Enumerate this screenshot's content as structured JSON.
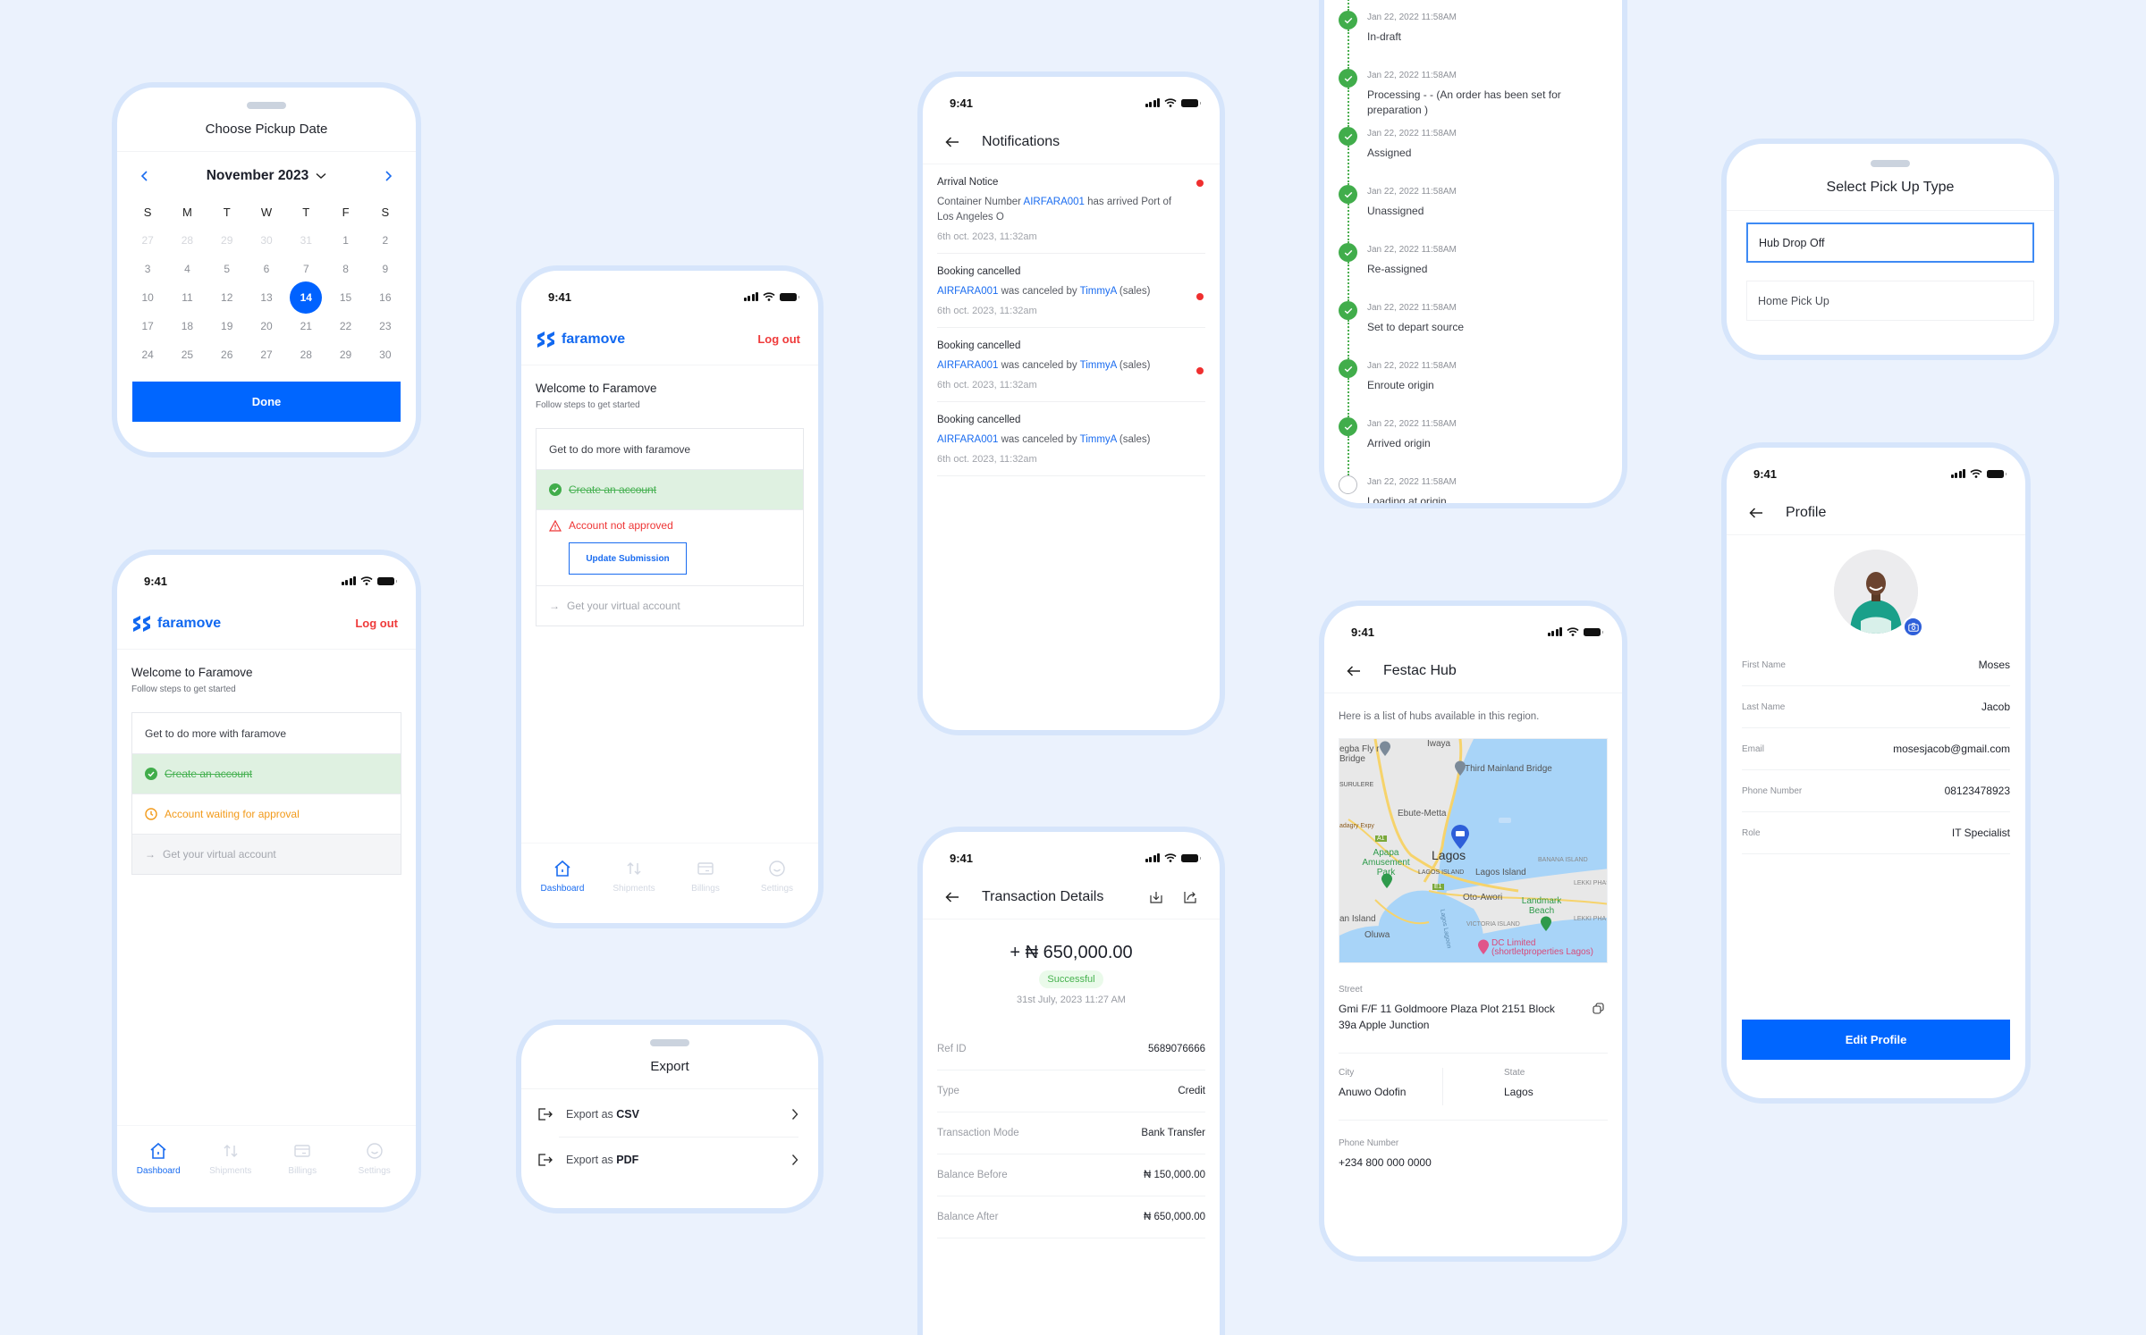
{
  "status_bar": {
    "time": "9:41"
  },
  "brand": {
    "name": "faramove",
    "primary_color": "#0066ff",
    "logout_color": "#ef3b3b"
  },
  "calendar_sheet": {
    "title": "Choose Pickup Date",
    "month_label": "November 2023",
    "weekdays": [
      "S",
      "M",
      "T",
      "W",
      "T",
      "F",
      "S"
    ],
    "weeks": [
      [
        {
          "d": "27",
          "out": true
        },
        {
          "d": "28",
          "out": true
        },
        {
          "d": "29",
          "out": true
        },
        {
          "d": "30",
          "out": true
        },
        {
          "d": "31",
          "out": true
        },
        {
          "d": "1"
        },
        {
          "d": "2"
        }
      ],
      [
        {
          "d": "3"
        },
        {
          "d": "4"
        },
        {
          "d": "5"
        },
        {
          "d": "6"
        },
        {
          "d": "7"
        },
        {
          "d": "8"
        },
        {
          "d": "9"
        }
      ],
      [
        {
          "d": "10"
        },
        {
          "d": "11"
        },
        {
          "d": "12"
        },
        {
          "d": "13"
        },
        {
          "d": "14",
          "selected": true
        },
        {
          "d": "15"
        },
        {
          "d": "16"
        }
      ],
      [
        {
          "d": "17"
        },
        {
          "d": "18"
        },
        {
          "d": "19"
        },
        {
          "d": "20"
        },
        {
          "d": "21"
        },
        {
          "d": "22"
        },
        {
          "d": "23"
        }
      ],
      [
        {
          "d": "24"
        },
        {
          "d": "25"
        },
        {
          "d": "26"
        },
        {
          "d": "27"
        },
        {
          "d": "28"
        },
        {
          "d": "29"
        },
        {
          "d": "30"
        }
      ]
    ],
    "selected_day": "14",
    "done_label": "Done"
  },
  "dashboard_pending": {
    "logout_label": "Log out",
    "welcome_title": "Welcome to Faramove",
    "welcome_subtitle": "Follow steps to get started",
    "steps_header": "Get to do more with faramove",
    "step_create": "Create an account",
    "step_status": "Account waiting for approval",
    "step_virtual": "Get your virtual account",
    "tabs": [
      "Dashboard",
      "Shipments",
      "Billings",
      "Settings"
    ],
    "active_tab": "Dashboard"
  },
  "dashboard_rejected": {
    "logout_label": "Log out",
    "welcome_title": "Welcome to Faramove",
    "welcome_subtitle": "Follow steps to get started",
    "steps_header": "Get to do more with faramove",
    "step_create": "Create an account",
    "step_status": "Account not approved",
    "update_button": "Update Submission",
    "step_virtual": "Get your virtual account",
    "tabs": [
      "Dashboard",
      "Shipments",
      "Billings",
      "Settings"
    ],
    "active_tab": "Dashboard"
  },
  "export_sheet": {
    "title": "Export",
    "options": [
      {
        "prefix": "Export as ",
        "format": "CSV"
      },
      {
        "prefix": "Export as ",
        "format": "PDF"
      }
    ]
  },
  "notifications": {
    "title": "Notifications",
    "items": [
      {
        "title": "Arrival Notice",
        "pre": "Container Number ",
        "link1": "AIRFARA001",
        "mid": " has arrived Port of Los Angeles O",
        "link2": "",
        "post": "",
        "time": "6th oct. 2023, 11:32am",
        "unread": true
      },
      {
        "title": "Booking cancelled",
        "pre": "",
        "link1": "AIRFARA001",
        "mid": " was canceled by ",
        "link2": "TimmyA",
        "post": " (sales)",
        "time": "6th oct. 2023, 11:32am",
        "unread": true
      },
      {
        "title": "Booking cancelled",
        "pre": "",
        "link1": "AIRFARA001",
        "mid": " was canceled by ",
        "link2": "TimmyA",
        "post": " (sales)",
        "time": "6th oct. 2023, 11:32am",
        "unread": true
      },
      {
        "title": "Booking cancelled",
        "pre": "",
        "link1": "AIRFARA001",
        "mid": " was canceled by ",
        "link2": "TimmyA",
        "post": " (sales)",
        "time": "6th oct. 2023, 11:32am",
        "unread": false
      }
    ]
  },
  "transaction": {
    "title": "Transaction Details",
    "amount": "+ ₦ 650,000.00",
    "status": "Successful",
    "date": "31st July, 2023 11:27 AM",
    "rows": [
      {
        "label": "Ref ID",
        "value": "5689076666"
      },
      {
        "label": "Type",
        "value": "Credit"
      },
      {
        "label": "Transaction Mode",
        "value": "Bank Transfer"
      },
      {
        "label": "Balance Before",
        "value": "₦ 150,000.00"
      },
      {
        "label": "Balance After",
        "value": "₦ 650,000.00"
      }
    ]
  },
  "timeline": {
    "items": [
      {
        "date": "Jan 22, 2022 11:58AM",
        "label": "In-draft",
        "done": true
      },
      {
        "date": "Jan 22, 2022 11:58AM",
        "label": "Processing - - (An order has been set for preparation )",
        "done": true
      },
      {
        "date": "Jan 22, 2022 11:58AM",
        "label": "Assigned",
        "done": true
      },
      {
        "date": "Jan 22, 2022 11:58AM",
        "label": "Unassigned",
        "done": true
      },
      {
        "date": "Jan 22, 2022 11:58AM",
        "label": "Re-assigned",
        "done": true
      },
      {
        "date": "Jan 22, 2022 11:58AM",
        "label": "Set to depart source",
        "done": true
      },
      {
        "date": "Jan 22, 2022 11:58AM",
        "label": "Enroute origin",
        "done": true
      },
      {
        "date": "Jan 22, 2022 11:58AM",
        "label": "Arrived origin",
        "done": true
      },
      {
        "date": "Jan 22, 2022 11:58AM",
        "label": "Loading at origin",
        "done": false
      }
    ]
  },
  "hub": {
    "title": "Festac Hub",
    "intro": "Here is a list of hubs available in this region.",
    "map_labels": [
      "Iwaya",
      "Third Mainland Bridge",
      "egba Fly r Bridge",
      "SURULERE",
      "Ebute-Metta",
      "adagry Expy",
      "A1",
      "Apapa Amusement Park",
      "Lagos",
      "LAGOS ISLAND",
      "Lagos Island",
      "BANANA ISLAND",
      "LEKKI PHASE",
      "E1",
      "Oto-Awori",
      "Landmark Beach",
      "LEKKI PHA",
      "VICTORIA ISLAND",
      "Lagos Lagoon",
      "an Island",
      "Oluwa",
      "DC Limited (shortletproperties Lagos)"
    ],
    "street_label": "Street",
    "street": "Gmi F/F 11 Goldmoore Plaza Plot 2151 Block 39a Apple Junction",
    "city_label": "City",
    "city": "Anuwo Odofin",
    "state_label": "State",
    "state": "Lagos",
    "phone_label": "Phone Number",
    "phone": "+234 800 000 0000"
  },
  "pickup_sheet": {
    "title": "Select Pick Up Type",
    "options": [
      "Hub Drop Off",
      "Home Pick Up"
    ],
    "selected": "Hub Drop Off"
  },
  "profile": {
    "title": "Profile",
    "fields": [
      {
        "label": "First Name",
        "value": "Moses"
      },
      {
        "label": "Last Name",
        "value": "Jacob"
      },
      {
        "label": "Email",
        "value": "mosesjacob@gmail.com"
      },
      {
        "label": "Phone Number",
        "value": "08123478923"
      },
      {
        "label": "Role",
        "value": "IT Specialist"
      }
    ],
    "edit_button": "Edit Profile"
  }
}
